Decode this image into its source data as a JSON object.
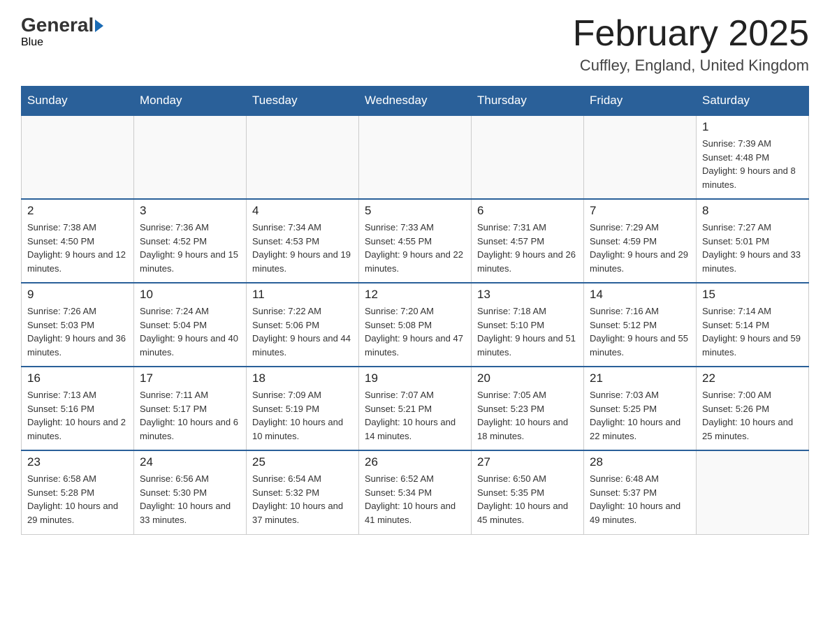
{
  "header": {
    "title": "February 2025",
    "subtitle": "Cuffley, England, United Kingdom",
    "logo_general": "General",
    "logo_blue": "Blue"
  },
  "days_of_week": [
    "Sunday",
    "Monday",
    "Tuesday",
    "Wednesday",
    "Thursday",
    "Friday",
    "Saturday"
  ],
  "weeks": [
    {
      "days": [
        {
          "number": "",
          "info": ""
        },
        {
          "number": "",
          "info": ""
        },
        {
          "number": "",
          "info": ""
        },
        {
          "number": "",
          "info": ""
        },
        {
          "number": "",
          "info": ""
        },
        {
          "number": "",
          "info": ""
        },
        {
          "number": "1",
          "info": "Sunrise: 7:39 AM\nSunset: 4:48 PM\nDaylight: 9 hours and 8 minutes."
        }
      ]
    },
    {
      "days": [
        {
          "number": "2",
          "info": "Sunrise: 7:38 AM\nSunset: 4:50 PM\nDaylight: 9 hours and 12 minutes."
        },
        {
          "number": "3",
          "info": "Sunrise: 7:36 AM\nSunset: 4:52 PM\nDaylight: 9 hours and 15 minutes."
        },
        {
          "number": "4",
          "info": "Sunrise: 7:34 AM\nSunset: 4:53 PM\nDaylight: 9 hours and 19 minutes."
        },
        {
          "number": "5",
          "info": "Sunrise: 7:33 AM\nSunset: 4:55 PM\nDaylight: 9 hours and 22 minutes."
        },
        {
          "number": "6",
          "info": "Sunrise: 7:31 AM\nSunset: 4:57 PM\nDaylight: 9 hours and 26 minutes."
        },
        {
          "number": "7",
          "info": "Sunrise: 7:29 AM\nSunset: 4:59 PM\nDaylight: 9 hours and 29 minutes."
        },
        {
          "number": "8",
          "info": "Sunrise: 7:27 AM\nSunset: 5:01 PM\nDaylight: 9 hours and 33 minutes."
        }
      ]
    },
    {
      "days": [
        {
          "number": "9",
          "info": "Sunrise: 7:26 AM\nSunset: 5:03 PM\nDaylight: 9 hours and 36 minutes."
        },
        {
          "number": "10",
          "info": "Sunrise: 7:24 AM\nSunset: 5:04 PM\nDaylight: 9 hours and 40 minutes."
        },
        {
          "number": "11",
          "info": "Sunrise: 7:22 AM\nSunset: 5:06 PM\nDaylight: 9 hours and 44 minutes."
        },
        {
          "number": "12",
          "info": "Sunrise: 7:20 AM\nSunset: 5:08 PM\nDaylight: 9 hours and 47 minutes."
        },
        {
          "number": "13",
          "info": "Sunrise: 7:18 AM\nSunset: 5:10 PM\nDaylight: 9 hours and 51 minutes."
        },
        {
          "number": "14",
          "info": "Sunrise: 7:16 AM\nSunset: 5:12 PM\nDaylight: 9 hours and 55 minutes."
        },
        {
          "number": "15",
          "info": "Sunrise: 7:14 AM\nSunset: 5:14 PM\nDaylight: 9 hours and 59 minutes."
        }
      ]
    },
    {
      "days": [
        {
          "number": "16",
          "info": "Sunrise: 7:13 AM\nSunset: 5:16 PM\nDaylight: 10 hours and 2 minutes."
        },
        {
          "number": "17",
          "info": "Sunrise: 7:11 AM\nSunset: 5:17 PM\nDaylight: 10 hours and 6 minutes."
        },
        {
          "number": "18",
          "info": "Sunrise: 7:09 AM\nSunset: 5:19 PM\nDaylight: 10 hours and 10 minutes."
        },
        {
          "number": "19",
          "info": "Sunrise: 7:07 AM\nSunset: 5:21 PM\nDaylight: 10 hours and 14 minutes."
        },
        {
          "number": "20",
          "info": "Sunrise: 7:05 AM\nSunset: 5:23 PM\nDaylight: 10 hours and 18 minutes."
        },
        {
          "number": "21",
          "info": "Sunrise: 7:03 AM\nSunset: 5:25 PM\nDaylight: 10 hours and 22 minutes."
        },
        {
          "number": "22",
          "info": "Sunrise: 7:00 AM\nSunset: 5:26 PM\nDaylight: 10 hours and 25 minutes."
        }
      ]
    },
    {
      "days": [
        {
          "number": "23",
          "info": "Sunrise: 6:58 AM\nSunset: 5:28 PM\nDaylight: 10 hours and 29 minutes."
        },
        {
          "number": "24",
          "info": "Sunrise: 6:56 AM\nSunset: 5:30 PM\nDaylight: 10 hours and 33 minutes."
        },
        {
          "number": "25",
          "info": "Sunrise: 6:54 AM\nSunset: 5:32 PM\nDaylight: 10 hours and 37 minutes."
        },
        {
          "number": "26",
          "info": "Sunrise: 6:52 AM\nSunset: 5:34 PM\nDaylight: 10 hours and 41 minutes."
        },
        {
          "number": "27",
          "info": "Sunrise: 6:50 AM\nSunset: 5:35 PM\nDaylight: 10 hours and 45 minutes."
        },
        {
          "number": "28",
          "info": "Sunrise: 6:48 AM\nSunset: 5:37 PM\nDaylight: 10 hours and 49 minutes."
        },
        {
          "number": "",
          "info": ""
        }
      ]
    }
  ]
}
